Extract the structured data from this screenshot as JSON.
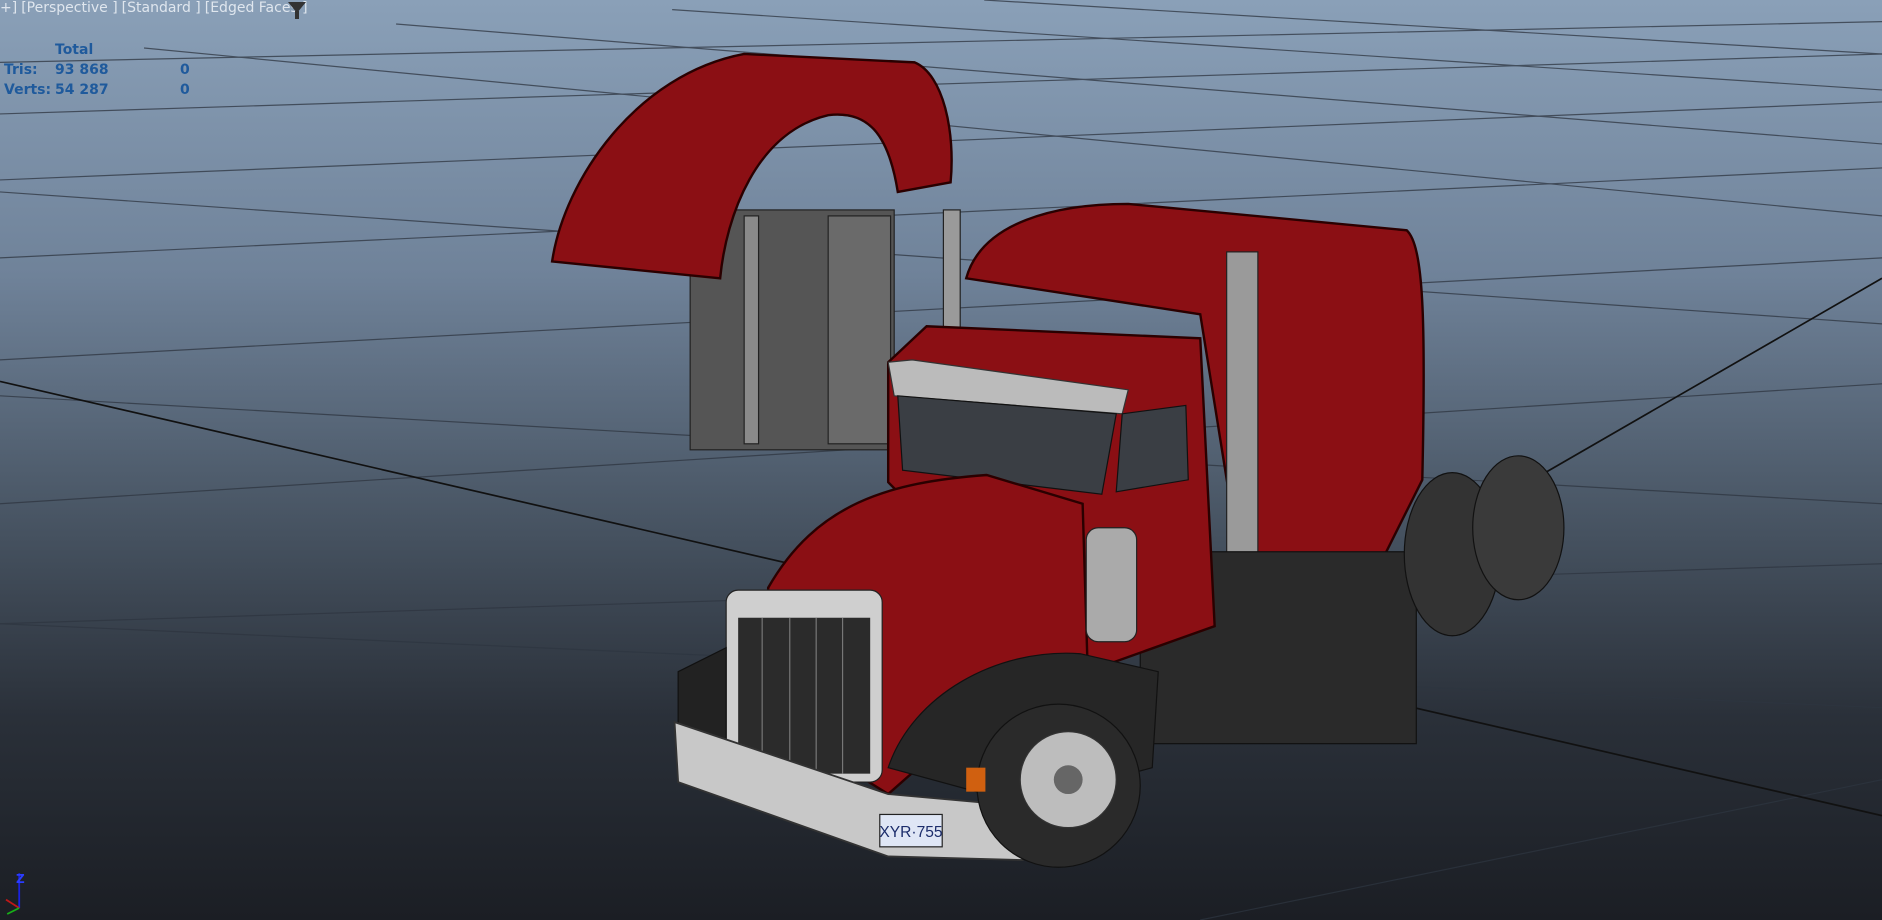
{
  "viewport_header": {
    "prefix": "+]",
    "camera": "[Perspective ]",
    "shading": "[Standard ]",
    "display": "[Edged Faces ]",
    "filter_icon": "funnel-icon"
  },
  "stats": {
    "column_header": "Total",
    "rows": [
      {
        "label": "Tris:",
        "total": "93 868",
        "selected": "0"
      },
      {
        "label": "Verts:",
        "total": "54 287",
        "selected": "0"
      }
    ]
  },
  "gizmo": {
    "z_label": "Z"
  },
  "model": {
    "license_plate": "XYR·755",
    "body_color": "#8b0f14"
  }
}
